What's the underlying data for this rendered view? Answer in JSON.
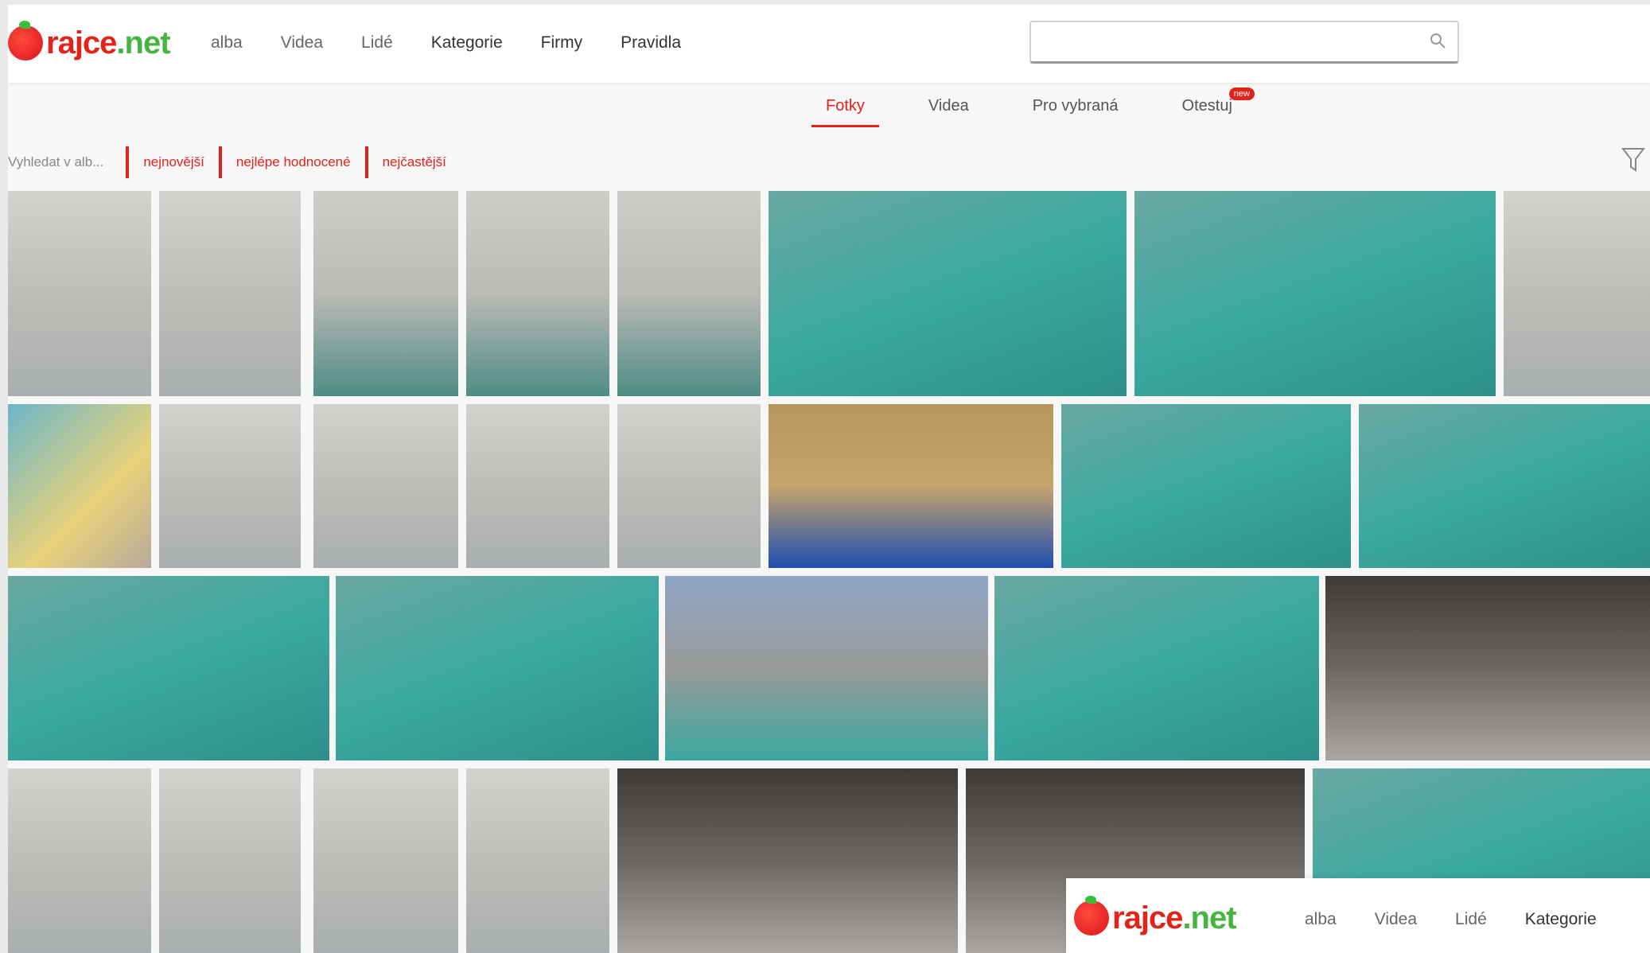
{
  "header": {
    "logo": {
      "text_main": "rajce",
      "text_accent": ".net"
    },
    "nav": [
      "alba",
      "Videa",
      "Lidé",
      "Kategorie",
      "Firmy",
      "Pravidla"
    ],
    "search": {
      "placeholder": ""
    }
  },
  "tabs": [
    {
      "label": "Fotky",
      "active": true
    },
    {
      "label": "Videa",
      "active": false
    },
    {
      "label": "Pro vybraná",
      "active": false
    },
    {
      "label": "Otestuj",
      "active": false,
      "badge": "new"
    }
  ],
  "filters": {
    "label": "Vyhledat v alb...",
    "items": [
      "nejnovější",
      "nejlépe hodnocené",
      "nejčastější"
    ]
  },
  "ad": {
    "logo": {
      "text_main": "rajce",
      "text_accent": ".net"
    },
    "nav": [
      "alba",
      "Videa",
      "Lidé",
      "Kategorie"
    ]
  },
  "colors": {
    "brand_red": "#e2231a",
    "brand_green": "#45b53f",
    "pool": "#3aa99f"
  }
}
